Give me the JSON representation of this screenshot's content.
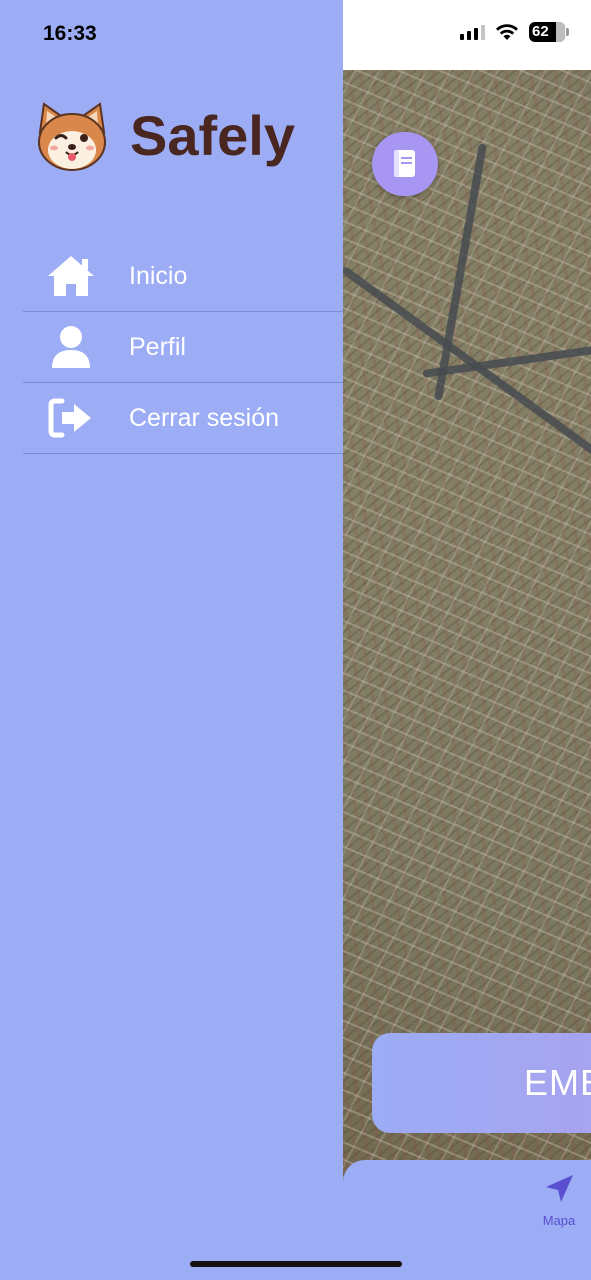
{
  "status_bar": {
    "time": "16:33",
    "battery": "62"
  },
  "brand": {
    "title": "Safely",
    "logo_icon": "shiba-dog-icon"
  },
  "menu": {
    "items": [
      {
        "label": "Inicio",
        "icon": "home-icon"
      },
      {
        "label": "Perfil",
        "icon": "user-icon"
      },
      {
        "label": "Cerrar sesión",
        "icon": "logout-icon"
      }
    ]
  },
  "background_app": {
    "emergency_label": "EME",
    "tabs": [
      {
        "label": "Mapa",
        "icon": "navigation-arrow-icon",
        "active": true
      }
    ],
    "guide_icon": "book-icon"
  },
  "colors": {
    "drawer_bg": "#9cacf5",
    "brand_text": "#4a2621",
    "accent": "#a796f2",
    "active_tab": "#5a4fd0"
  }
}
